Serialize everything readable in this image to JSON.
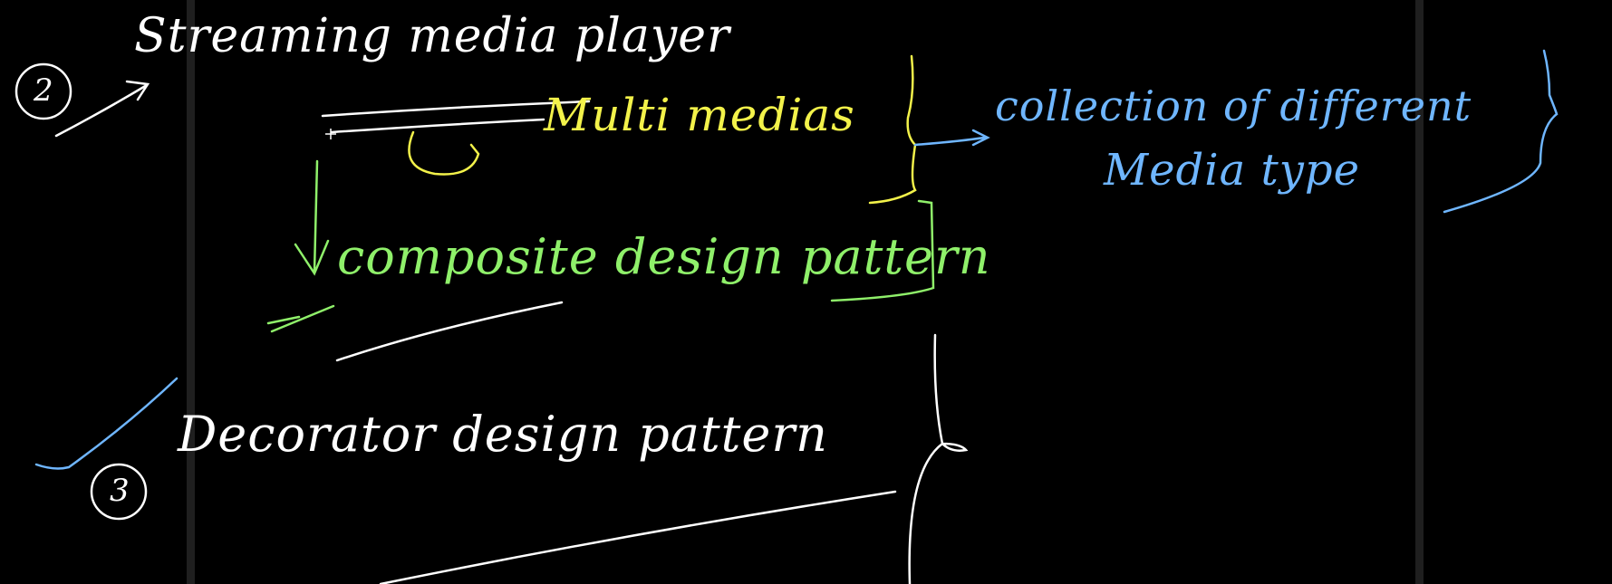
{
  "notes": {
    "item2_number": "2",
    "item2_title": "Streaming media player",
    "multi_medias": "Multi medias",
    "collection_line1": "collection of different",
    "collection_line2": "Media type",
    "composite": "composite design pattern",
    "item3_number": "3",
    "item3_title": "Decorator design pattern"
  },
  "colors": {
    "background": "#000000",
    "white": "#ffffff",
    "yellow": "#f3f24a",
    "green": "#8ff06a",
    "blue": "#6fb6ff",
    "guide": "#1f1f1f"
  }
}
